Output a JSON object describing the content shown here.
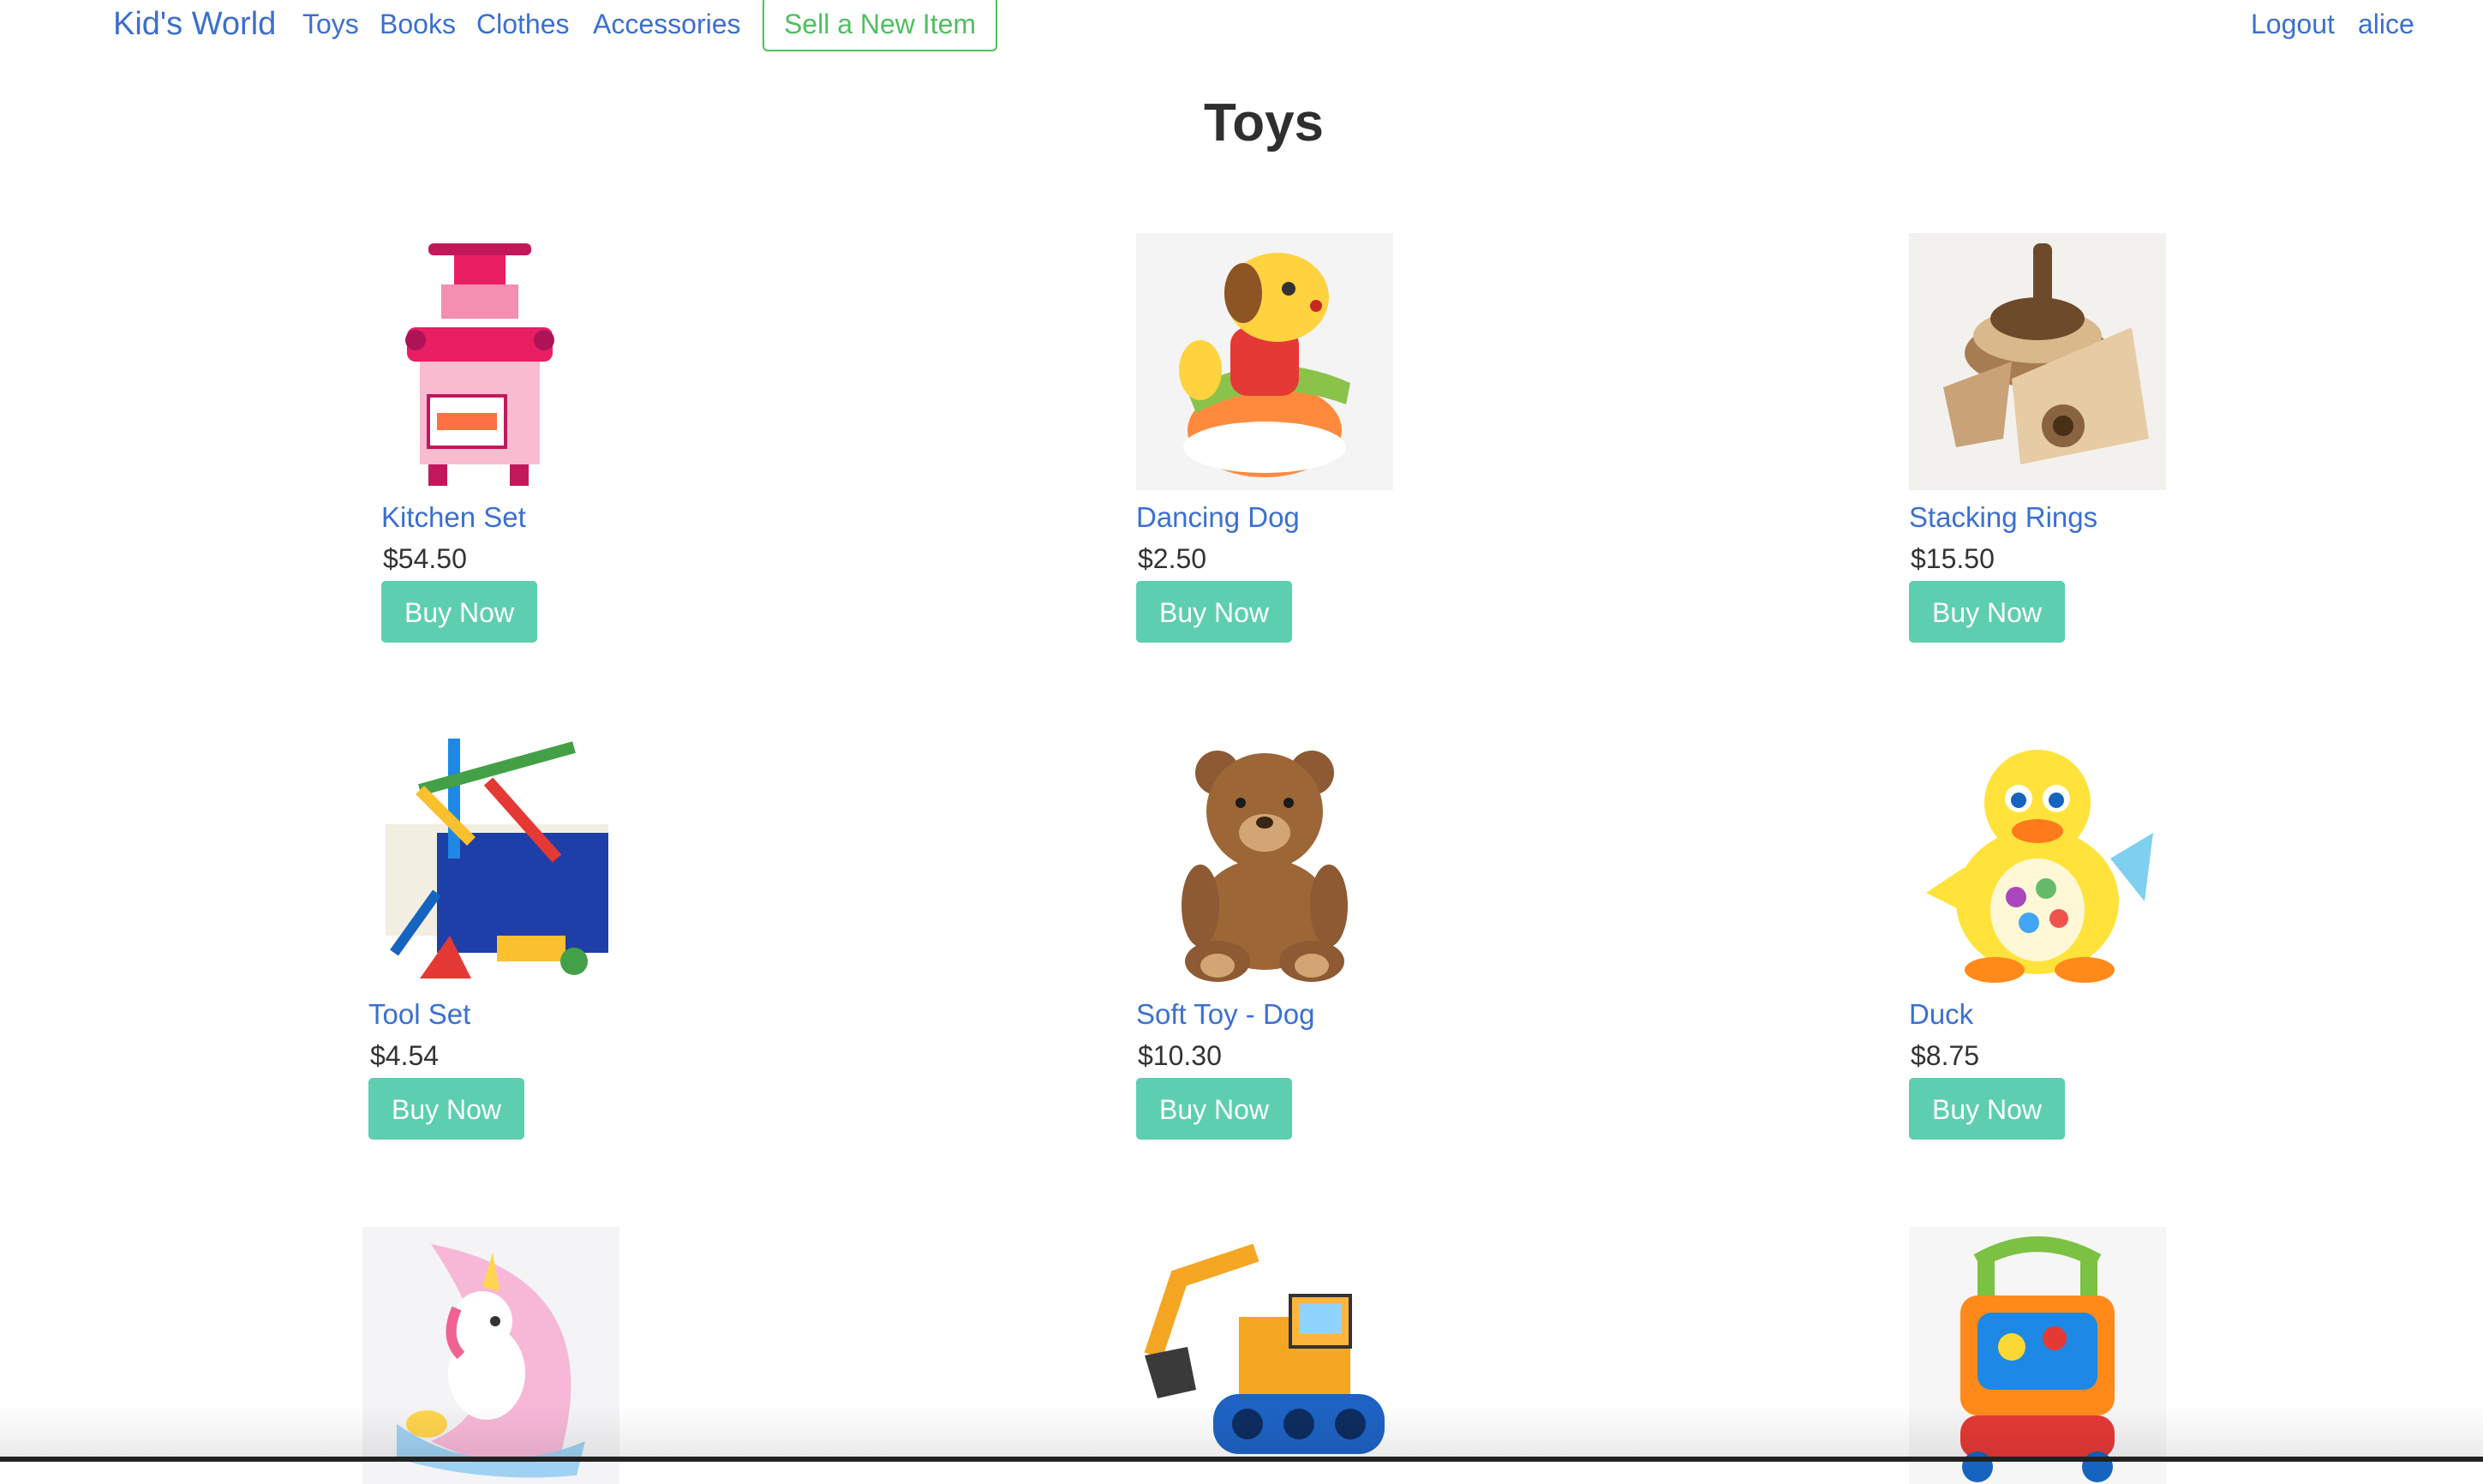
{
  "nav": {
    "brand": "Kid's World",
    "links": [
      "Toys",
      "Books",
      "Clothes",
      "Accessories"
    ],
    "sell_label": "Sell a New Item",
    "logout_label": "Logout",
    "username": "alice"
  },
  "page": {
    "title": "Toys"
  },
  "products": [
    {
      "name": "Kitchen Set",
      "price": "$54.50",
      "buy_label": "Buy Now",
      "icon": "kitchen-set-image"
    },
    {
      "name": "Dancing Dog",
      "price": "$2.50",
      "buy_label": "Buy Now",
      "icon": "dancing-dog-image"
    },
    {
      "name": "Stacking Rings",
      "price": "$15.50",
      "buy_label": "Buy Now",
      "icon": "stacking-rings-image"
    },
    {
      "name": "Tool Set",
      "price": "$4.54",
      "buy_label": "Buy Now",
      "icon": "tool-set-image"
    },
    {
      "name": "Soft Toy - Dog",
      "price": "$10.30",
      "buy_label": "Buy Now",
      "icon": "teddy-bear-image"
    },
    {
      "name": "Duck",
      "price": "$8.75",
      "buy_label": "Buy Now",
      "icon": "duck-toy-image"
    },
    {
      "icon": "unicorn-moon-image"
    },
    {
      "icon": "excavator-image"
    },
    {
      "icon": "baby-walker-image"
    }
  ],
  "colors": {
    "link": "#3b6fd0",
    "sell_border": "#4fbf5f",
    "buy_button": "#5dcfb0"
  }
}
